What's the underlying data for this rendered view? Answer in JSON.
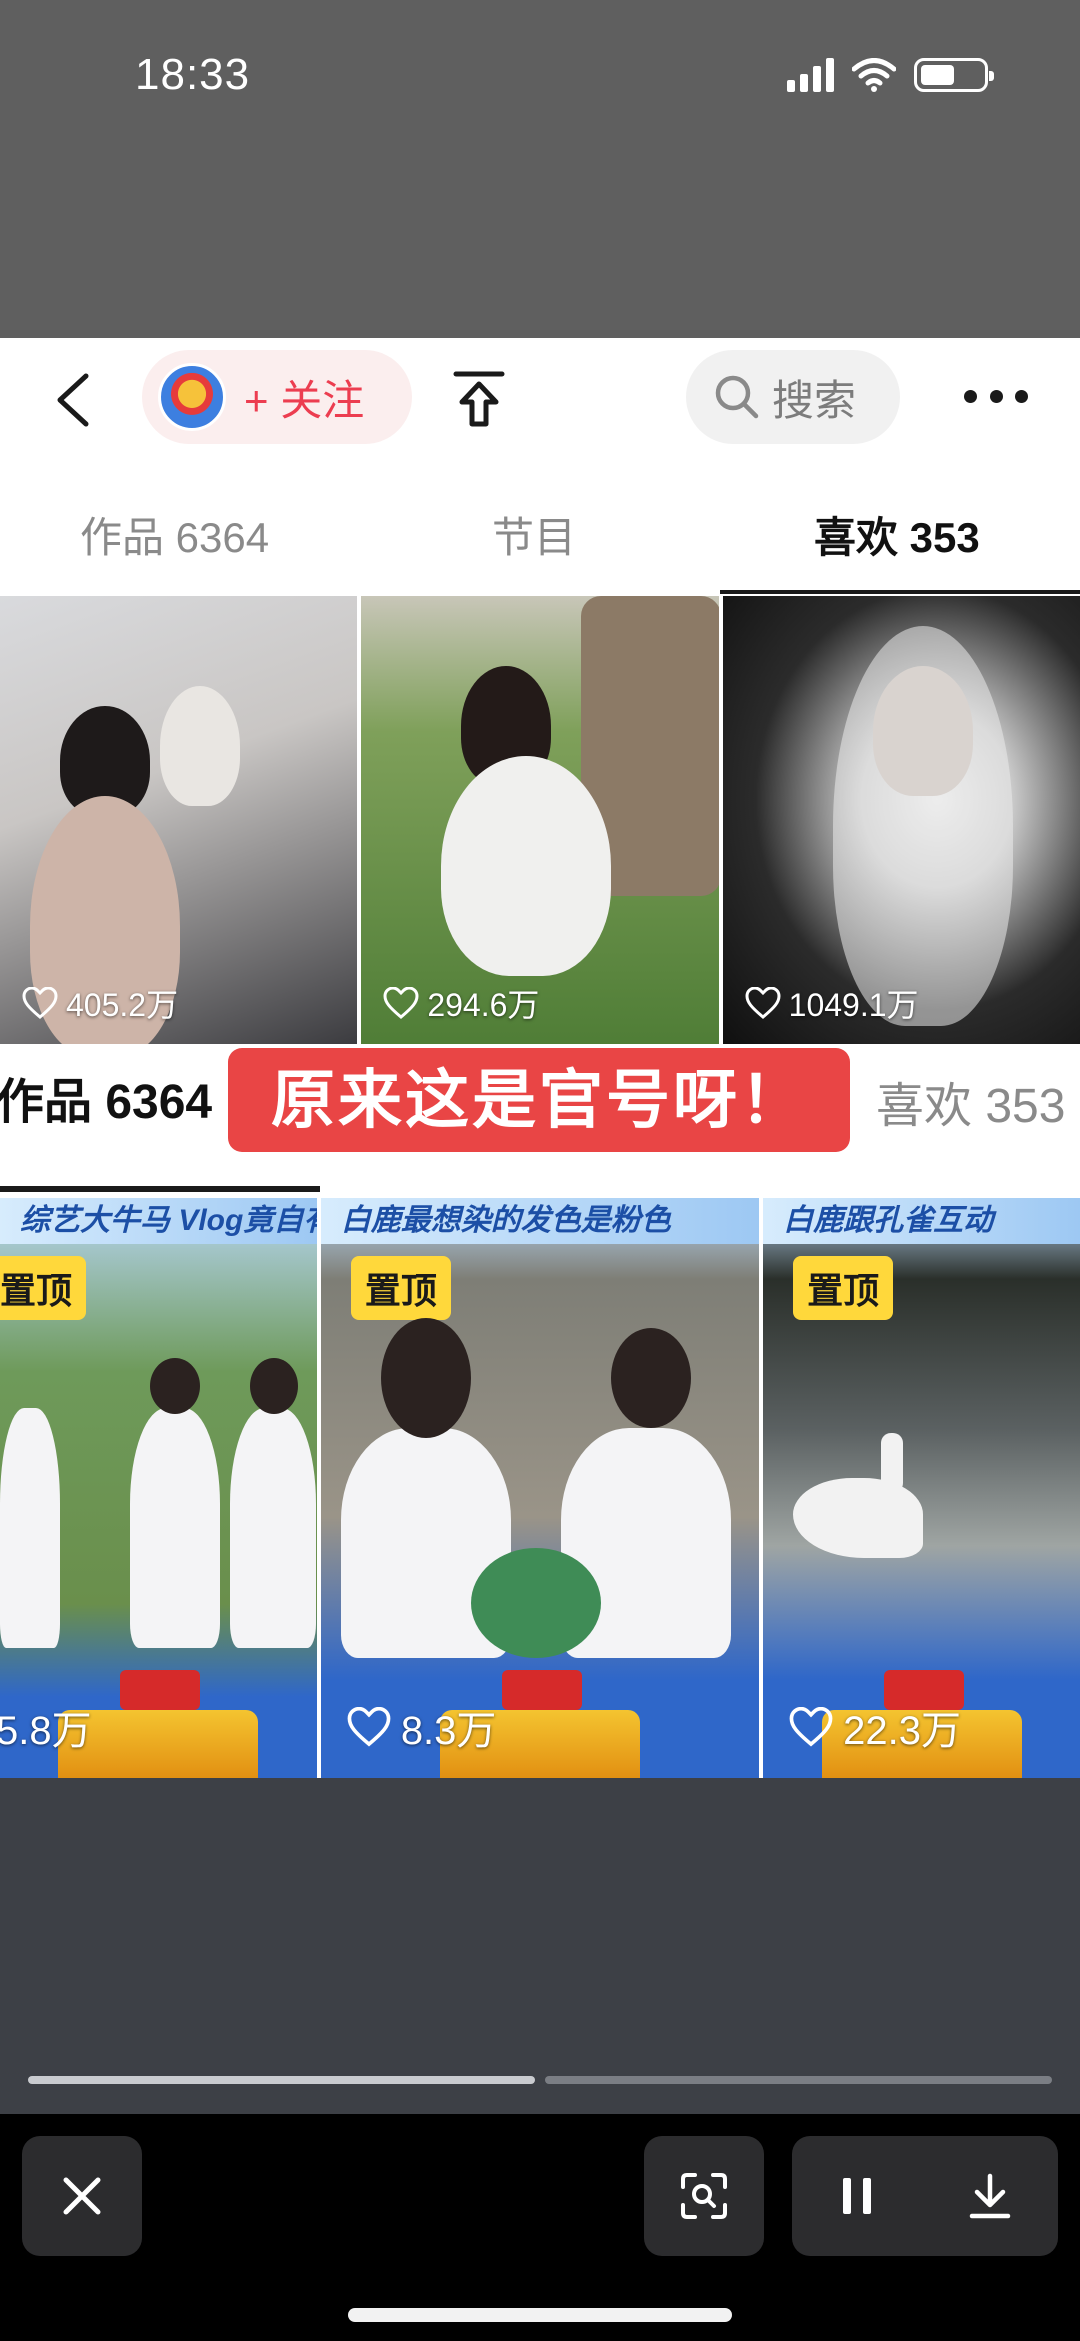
{
  "status_bar": {
    "time": "18:33"
  },
  "header": {
    "follow_label": "+ 关注",
    "search_label": "搜索"
  },
  "tabs": [
    {
      "label": "作品 6364",
      "active": false
    },
    {
      "label": "节目",
      "active": false
    },
    {
      "label": "喜欢 353",
      "active": true
    }
  ],
  "grid_top": [
    {
      "likes": "405.2万"
    },
    {
      "likes": "294.6万"
    },
    {
      "likes": "1049.1万"
    }
  ],
  "zoom_strip": {
    "left_tab": "作品 6364",
    "caption": "原来这是官号呀！",
    "right_tab": "喜欢 353"
  },
  "grid_bottom": [
    {
      "banner": "综艺大牛马 Vlog竟自有了",
      "pin": "置顶",
      "likes": "5.8万"
    },
    {
      "banner": "白鹿最想染的发色是粉色",
      "pin": "置顶",
      "likes": "8.3万"
    },
    {
      "banner": "白鹿跟孔雀互动",
      "pin": "置顶",
      "likes": "22.3万"
    }
  ],
  "colors": {
    "accent_red": "#ec3d50",
    "caption_red": "#e94545",
    "pin_yellow": "#ffd83b"
  },
  "icons": {
    "back": "chevron-left-icon",
    "share": "share-up-icon",
    "search": "search-icon",
    "more": "more-dots-icon",
    "like": "heart-icon",
    "close": "close-icon",
    "scan": "scan-search-icon",
    "pause": "pause-icon",
    "download": "download-icon"
  },
  "progress": {
    "segments": 2,
    "current": 1
  }
}
